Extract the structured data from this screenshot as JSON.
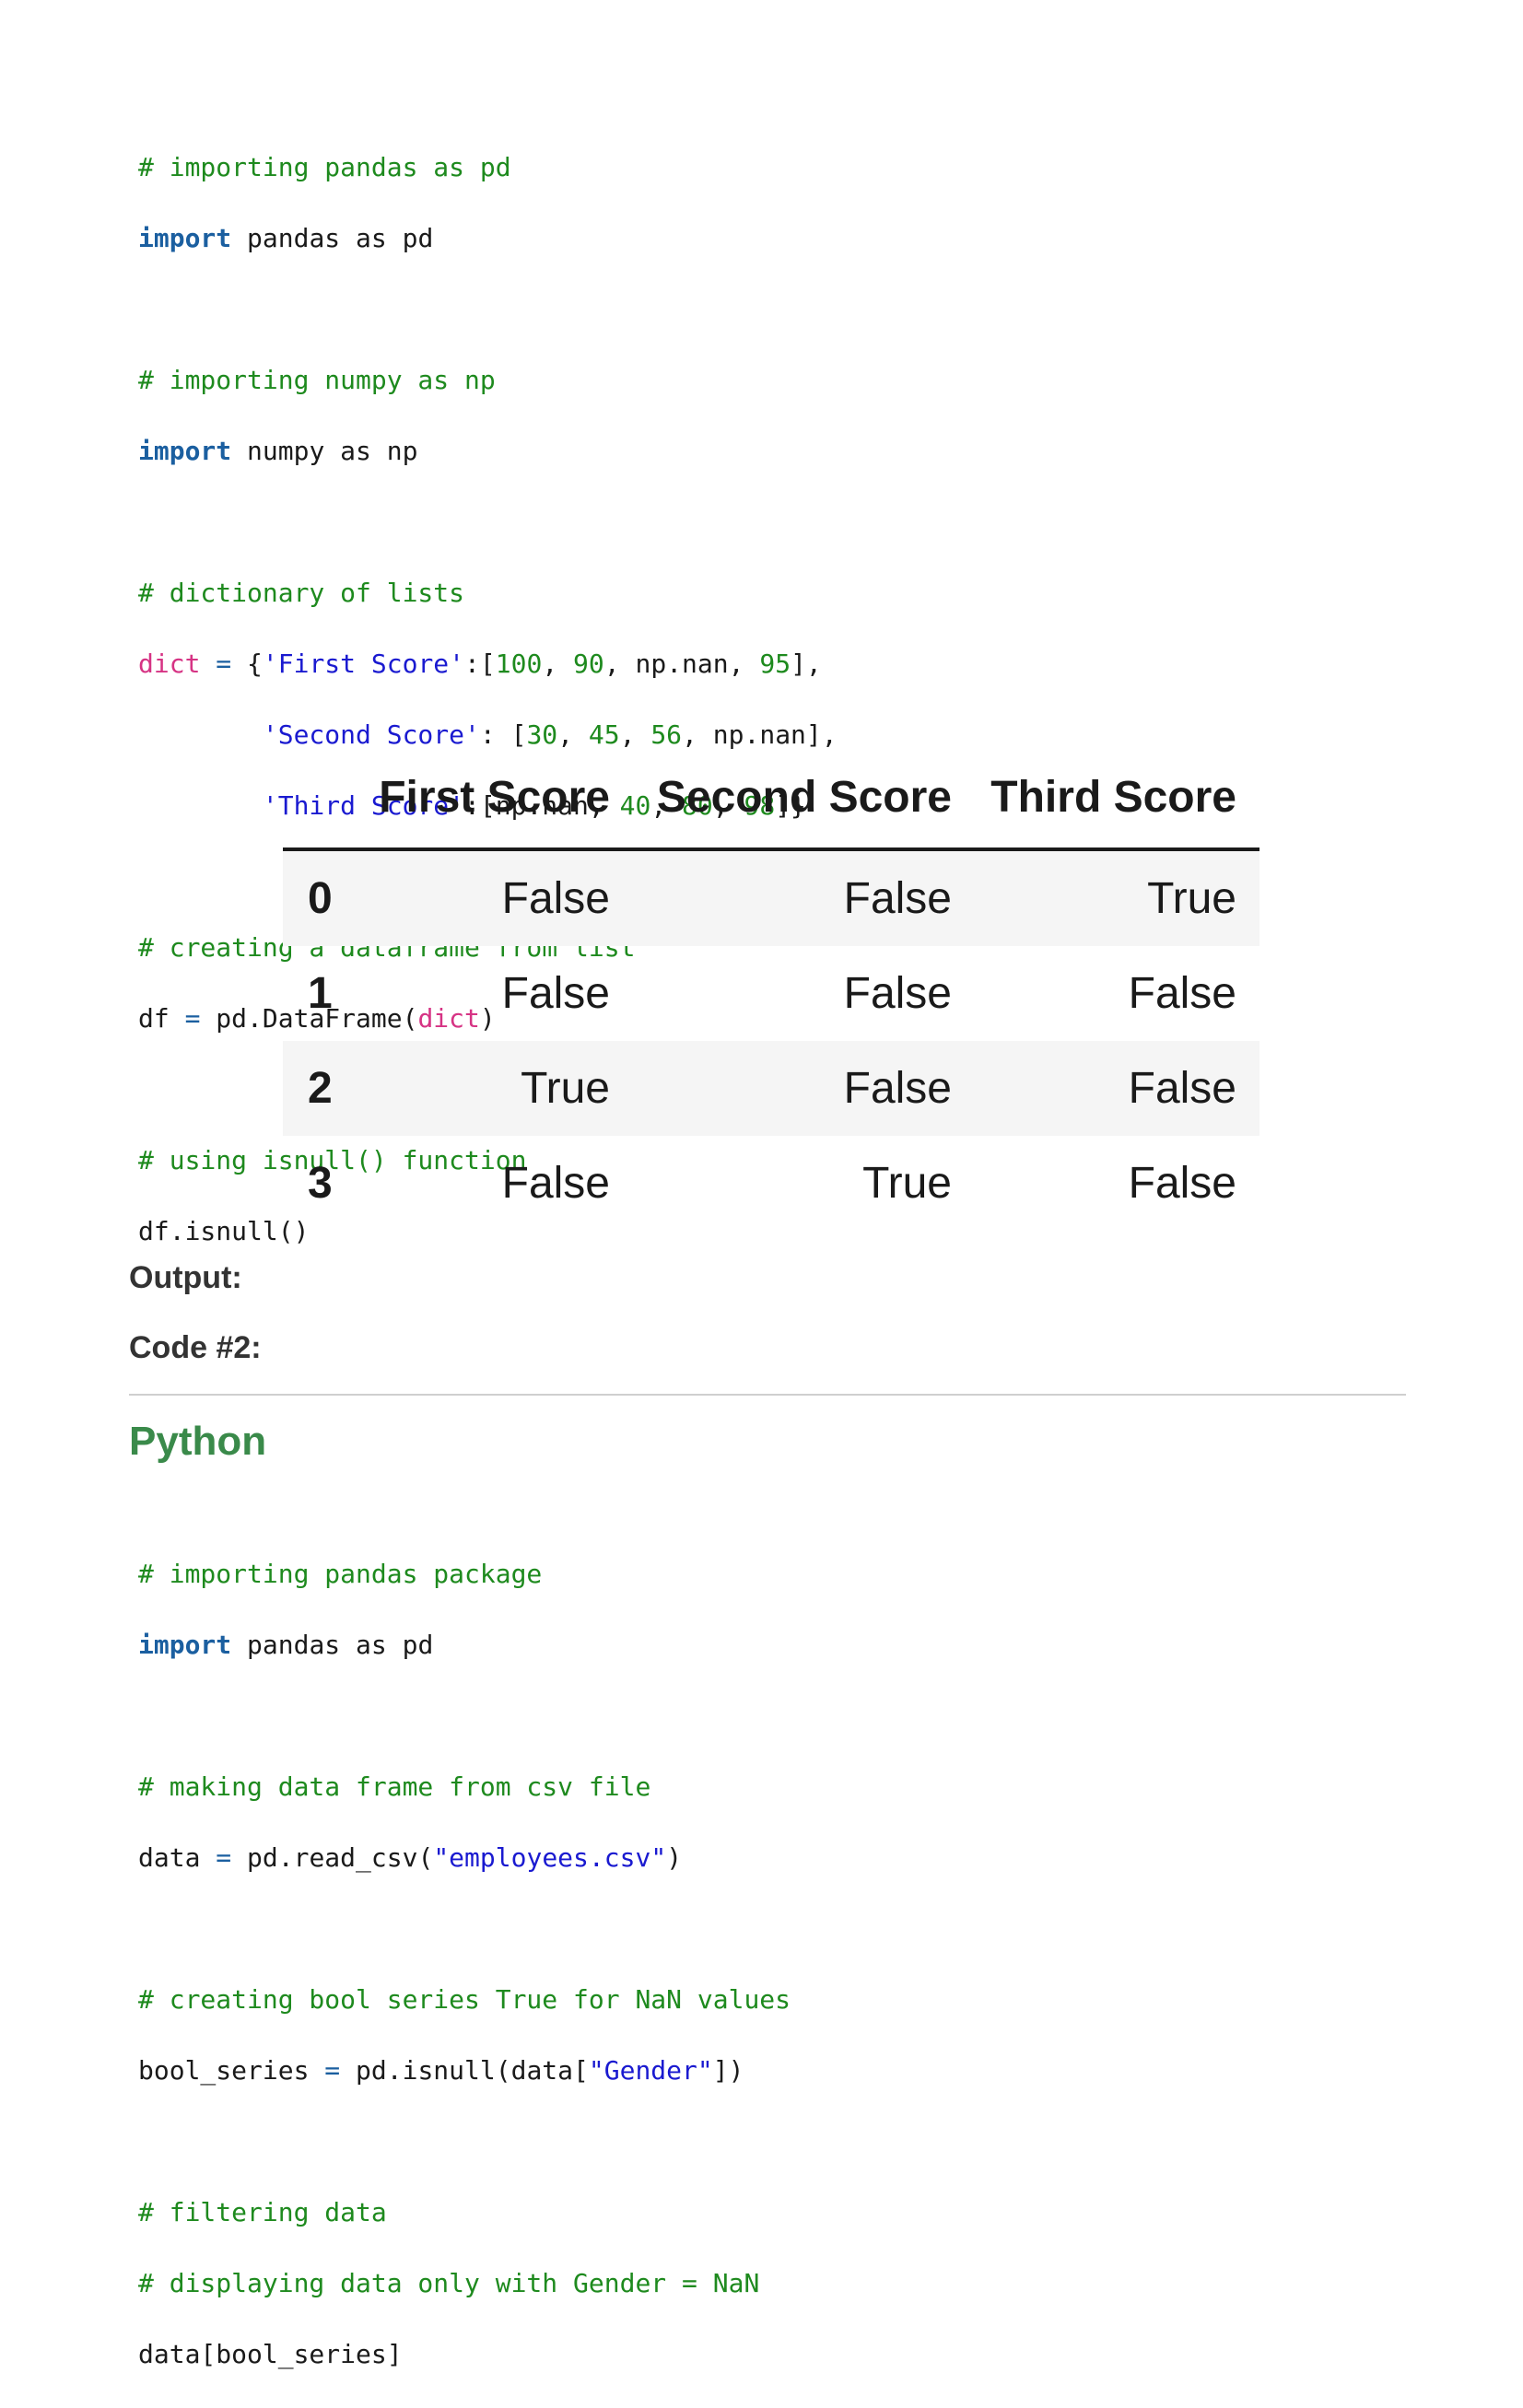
{
  "code1": {
    "c_import_pandas": "# importing pandas as pd",
    "import_kw1": "import",
    "import_pandas_rest": " pandas as pd",
    "c_import_numpy": "# importing numpy as np",
    "import_kw2": "import",
    "import_numpy_rest": " numpy as np",
    "c_dict": "# dictionary of lists",
    "dict_name": "dict",
    "assign": " = ",
    "brace_open": "{",
    "key1": "'First Score'",
    "key2": "'Second Score'",
    "key3": "'Third Score'",
    "c_create_df": "# creating a dataframe from list",
    "df_line_a": "df ",
    "eq": "=",
    "df_line_b": " pd.DataFrame(",
    "df_line_arg": "dict",
    "df_line_c": ")",
    "c_isnull": "# using isnull() function",
    "isnull_call": "df.isnull()"
  },
  "output_table": {
    "columns": [
      "First Score",
      "Second Score",
      "Third Score"
    ],
    "rows": [
      {
        "index": "0",
        "values": [
          "False",
          "False",
          "True"
        ]
      },
      {
        "index": "1",
        "values": [
          "False",
          "False",
          "False"
        ]
      },
      {
        "index": "2",
        "values": [
          "True",
          "False",
          "False"
        ]
      },
      {
        "index": "3",
        "values": [
          "False",
          "True",
          "False"
        ]
      }
    ]
  },
  "labels": {
    "output": "Output:",
    "code2": "Code #2:",
    "language": "Python"
  },
  "code2": {
    "c_import": "# importing pandas package",
    "import_kw": "import",
    "import_rest": " pandas as pd",
    "c_read": "# making data frame from csv file",
    "read_a": "data ",
    "eq": "=",
    "read_b": " pd.read_csv(",
    "read_str": "\"employees.csv\"",
    "read_c": ")",
    "c_bool": "# creating bool series True for NaN values",
    "bool_a": "bool_series ",
    "bool_b": " pd.isnull(data[",
    "bool_str": "\"Gender\"",
    "bool_c": "])",
    "c_filter": "# filtering data",
    "c_display": "# displaying data only with Gender = NaN",
    "final": "data[bool_series]"
  },
  "colors": {
    "comment": "#1e8a1e",
    "keyword": "#1b5fa0",
    "identifier": "#d63384",
    "string": "#1a1ad0",
    "heading_green": "#3a8a4a"
  }
}
